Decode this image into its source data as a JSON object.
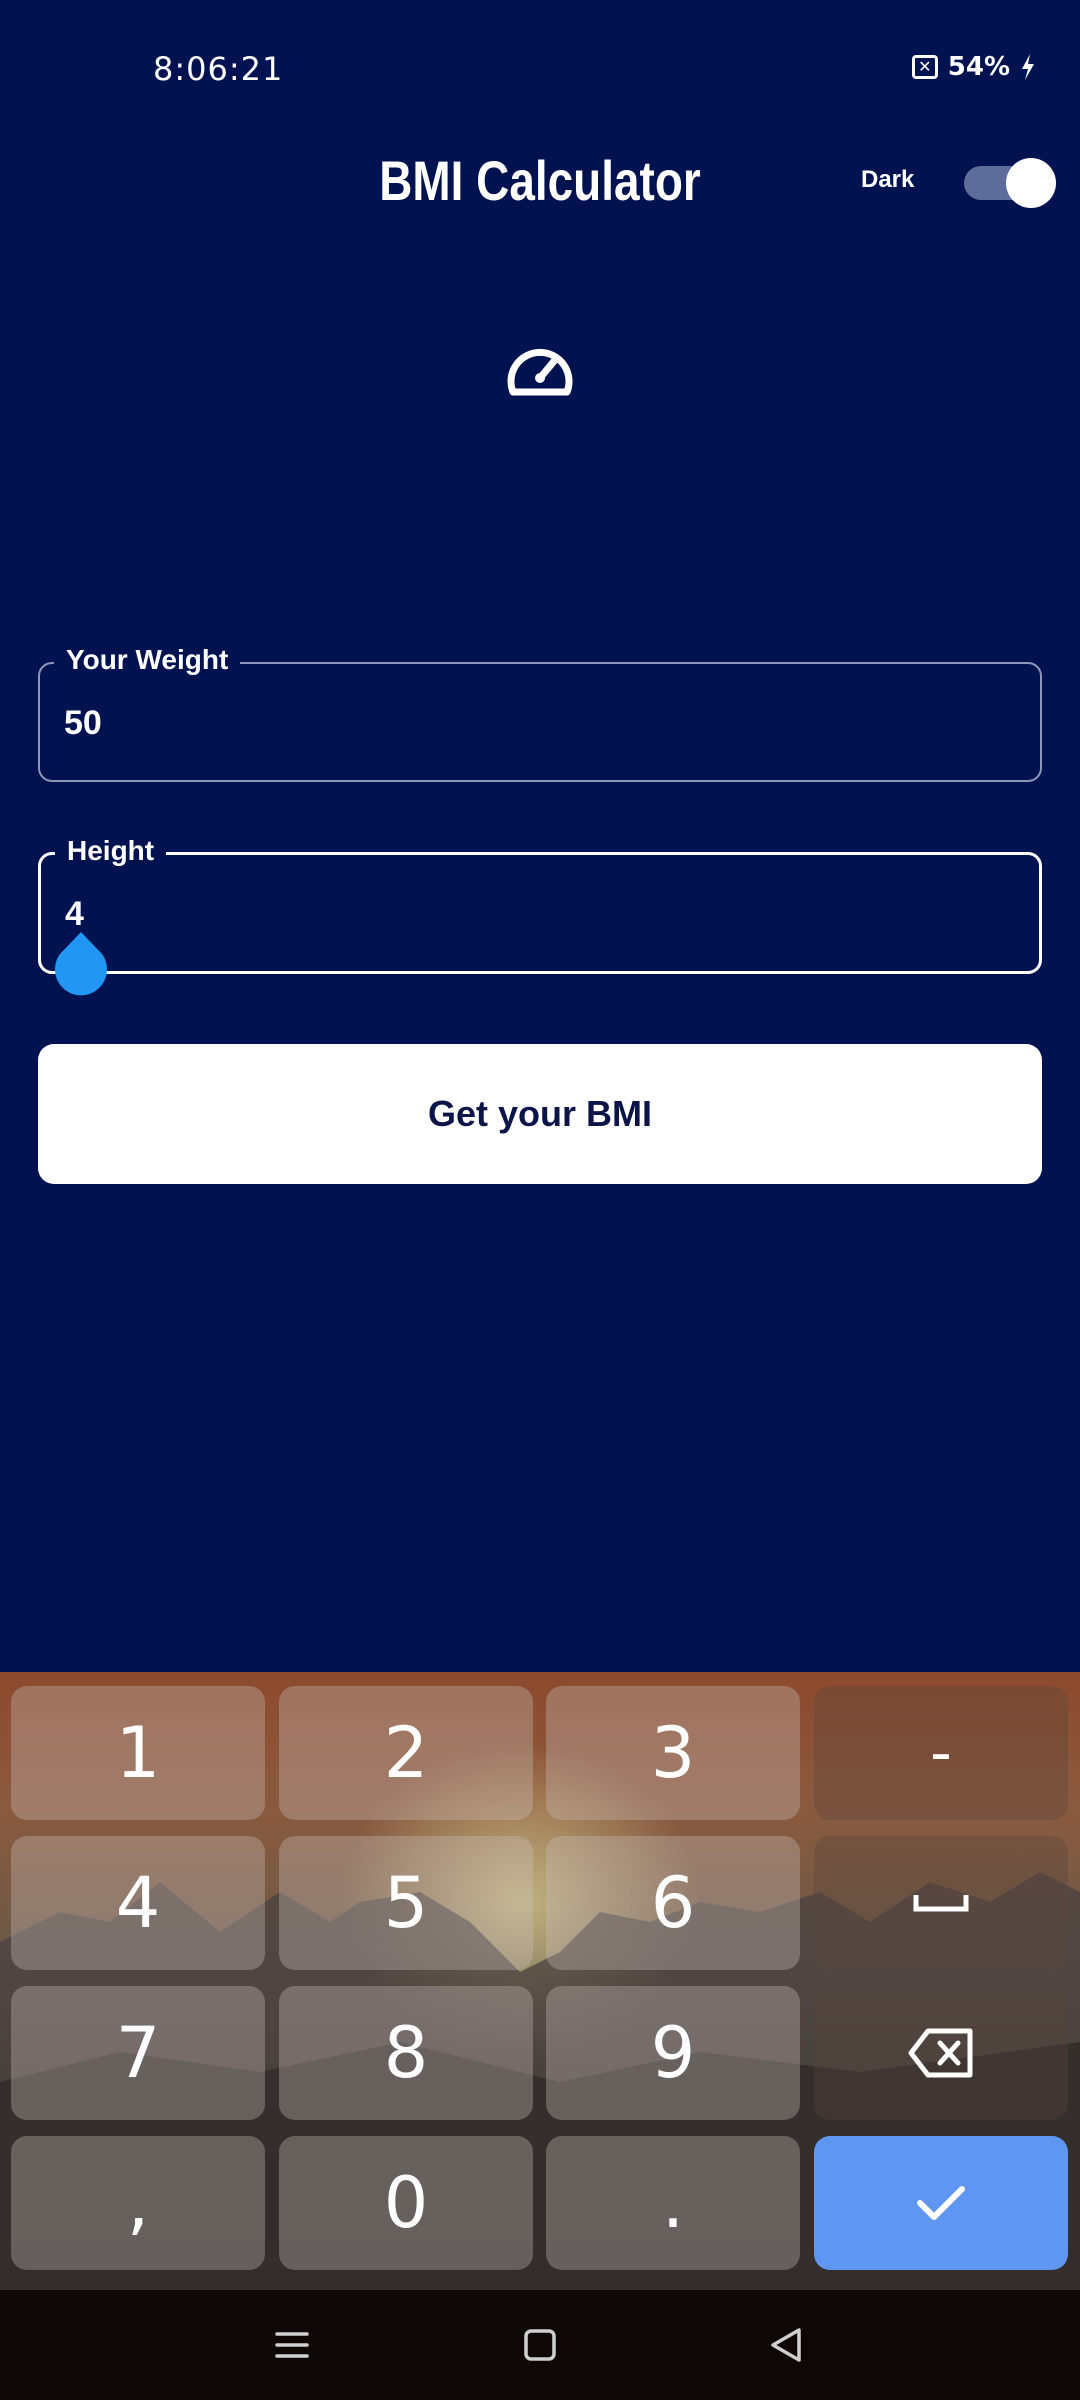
{
  "status_bar": {
    "time": "8:06:21",
    "battery": "54%"
  },
  "header": {
    "title": "BMI Calculator",
    "theme_label": "Dark",
    "dark_mode_on": true
  },
  "form": {
    "weight": {
      "label": "Your Weight",
      "value": "50"
    },
    "height": {
      "label": "Height",
      "value": "4"
    },
    "submit_label": "Get your BMI"
  },
  "keyboard": {
    "rows": [
      [
        "1",
        "2",
        "3",
        "-"
      ],
      [
        "4",
        "5",
        "6",
        "space"
      ],
      [
        "7",
        "8",
        "9",
        "backspace"
      ],
      [
        ",",
        "0",
        ".",
        "done"
      ]
    ],
    "accent": "#5f96f2"
  },
  "colors": {
    "background": "#00124f",
    "button": "#ffffff",
    "button_text": "#0c1547",
    "caret": "#2196f3"
  }
}
